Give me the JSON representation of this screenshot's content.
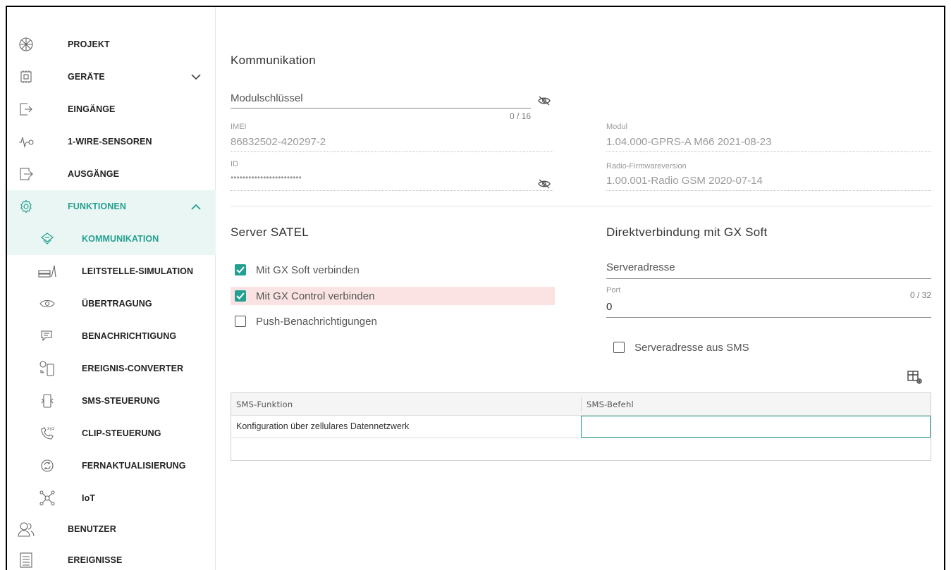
{
  "colors": {
    "accent": "#23a08f",
    "active_bg": "#eaf6f4",
    "highlight": "#fbe3e3"
  },
  "sidebar": {
    "items": [
      {
        "label": "PROJEKT",
        "icon": "project-icon"
      },
      {
        "label": "GERÄTE",
        "icon": "devices-chip-icon",
        "chevron": "down"
      },
      {
        "label": "EINGÄNGE",
        "icon": "inputs-icon"
      },
      {
        "label": "1-WIRE-SENSOREN",
        "icon": "1wire-sensor-icon"
      },
      {
        "label": "AUSGÄNGE",
        "icon": "outputs-icon"
      },
      {
        "label": "FUNKTIONEN",
        "icon": "gear-icon",
        "chevron": "up"
      },
      {
        "label": "KOMMUNIKATION",
        "icon": "communication-icon"
      },
      {
        "label": "LEITSTELLE-SIMULATION",
        "icon": "monitoring-station-icon"
      },
      {
        "label": "ÜBERTRAGUNG",
        "icon": "eye-transmission-icon"
      },
      {
        "label": "BENACHRICHTIGUNG",
        "icon": "notification-chat-icon"
      },
      {
        "label": "EREIGNIS-CONVERTER",
        "icon": "event-converter-icon"
      },
      {
        "label": "SMS-STEUERUNG",
        "icon": "sms-control-icon"
      },
      {
        "label": "CLIP-STEUERUNG",
        "icon": "clip-phone-icon"
      },
      {
        "label": "FERNAKTUALISIERUNG",
        "icon": "remote-update-icon"
      },
      {
        "label": "IoT",
        "icon": "iot-network-icon"
      },
      {
        "label": "BENUTZER",
        "icon": "users-icon"
      },
      {
        "label": "EREIGNISSE",
        "icon": "events-list-icon"
      }
    ]
  },
  "main": {
    "title": "Kommunikation",
    "module_key": {
      "label": "Modulschlüssel",
      "counter": "0 / 16"
    },
    "imei": {
      "label": "IMEI",
      "value": "86832502-420297-2"
    },
    "id": {
      "label": "ID",
      "value": "••••••••••••••••••••••••"
    },
    "modul": {
      "label": "Modul",
      "value": "1.04.000-GPRS-A M66 2021-08-23"
    },
    "radio_fw": {
      "label": "Radio-Firmwareversion",
      "value": "1.00.001-Radio GSM 2020-07-14"
    },
    "server_satel": {
      "title": "Server SATEL",
      "options": [
        {
          "label": "Mit GX Soft verbinden",
          "checked": true
        },
        {
          "label": "Mit GX Control verbinden",
          "checked": true
        },
        {
          "label": "Push-Benachrichtigungen",
          "checked": false
        }
      ]
    },
    "direct": {
      "title": "Direktverbindung mit GX Soft",
      "server_address": {
        "label": "Serveradresse",
        "counter": "0 / 32"
      },
      "port": {
        "label": "Port",
        "value": "0"
      },
      "sms_option": {
        "label": "Serveradresse aus SMS",
        "checked": false
      }
    },
    "table": {
      "headers": [
        "SMS-Funktion",
        "SMS-Befehl"
      ],
      "rows": [
        {
          "function": "Konfiguration über zellulares Datennetzwerk",
          "command": ""
        }
      ]
    }
  }
}
